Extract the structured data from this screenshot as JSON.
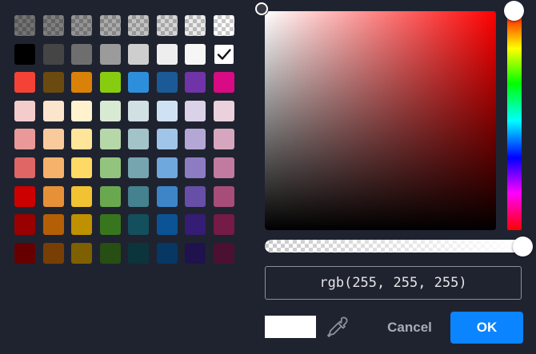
{
  "swatches": {
    "transparent_row": [
      {
        "color": "#000000",
        "alpha": 0.55
      },
      {
        "color": "#000000",
        "alpha": 0.5
      },
      {
        "color": "#000000",
        "alpha": 0.42
      },
      {
        "color": "#000000",
        "alpha": 0.33
      },
      {
        "color": "#000000",
        "alpha": 0.24
      },
      {
        "color": "#000000",
        "alpha": 0.16
      },
      {
        "color": "#000000",
        "alpha": 0.08
      },
      {
        "color": "#000000",
        "alpha": 0.0
      }
    ],
    "rows": [
      [
        "#000000",
        "#454545",
        "#6e6e6e",
        "#9b9b9b",
        "#cecece",
        "#eeeeee",
        "#f6f6f6",
        "#ffffff"
      ],
      [
        "#f44336",
        "#6b4a10",
        "#d98207",
        "#88cc10",
        "#2d8fdc",
        "#1b5a96",
        "#7034a8",
        "#d80b84"
      ],
      [
        "#f4cccc",
        "#fce5cd",
        "#fff2cc",
        "#d9ead3",
        "#d0e0e3",
        "#cfe2f3",
        "#d9d2e9",
        "#ead1dc"
      ],
      [
        "#ea9999",
        "#f9cb9c",
        "#ffe599",
        "#b6d7a8",
        "#a2c4c9",
        "#9fc5e8",
        "#b4a7d6",
        "#d5a6bd"
      ],
      [
        "#e06666",
        "#f6b26b",
        "#ffd966",
        "#93c47d",
        "#76a5af",
        "#6fa8dc",
        "#8e7cc3",
        "#c27ba0"
      ],
      [
        "#cc0000",
        "#e69138",
        "#f1c232",
        "#6aa84f",
        "#45818e",
        "#3d85c6",
        "#674ea7",
        "#a64d79"
      ],
      [
        "#990000",
        "#b45f06",
        "#bf9000",
        "#38761d",
        "#134f5c",
        "#0b5394",
        "#351c75",
        "#741b47"
      ],
      [
        "#660000",
        "#783f04",
        "#7f6000",
        "#274e13",
        "#0c343d",
        "#073763",
        "#20124d",
        "#4c1130"
      ]
    ],
    "selected": "#ffffff"
  },
  "picker": {
    "hue_color": "#ff0000",
    "value_text": "rgb(255, 255, 255)",
    "preview_color": "#ffffff",
    "alpha": 1.0
  },
  "buttons": {
    "cancel_label": "Cancel",
    "ok_label": "OK",
    "ok_color": "#0a84ff"
  },
  "icons": {
    "selected": "check-icon",
    "eyedropper": "eyedropper-icon"
  }
}
